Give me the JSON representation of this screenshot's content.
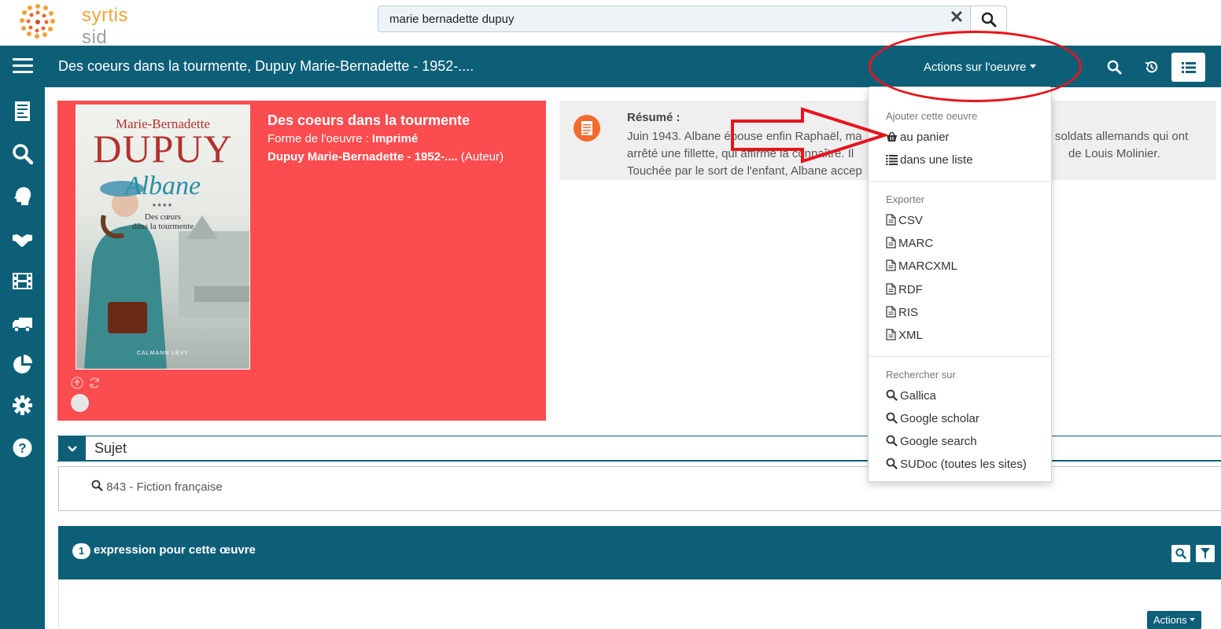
{
  "app": {
    "logo_main": "syrtis",
    "logo_sub": "sid"
  },
  "search": {
    "value": "marie bernadette dupuy"
  },
  "header": {
    "title": "Des coeurs dans la tourmente, Dupuy Marie-Bernadette - 1952-....",
    "actions_label": "Actions sur l'oeuvre"
  },
  "record": {
    "title": "Des coeurs dans la tourmente",
    "form_label": "Forme de l'oeuvre : ",
    "form_value": "Imprimé",
    "author": "Dupuy Marie-Bernadette - 1952-....",
    "author_role": "(Auteur)",
    "cover": {
      "author_first": "Marie-Bernadette",
      "author_last": "DUPUY",
      "series": "Albane",
      "stars": "****",
      "subtitle_line1": "Des cœurs",
      "subtitle_line2": "dans la tourmente",
      "publisher": "CALMANN LÉVY"
    }
  },
  "resume": {
    "label": "Résumé :",
    "line1": "Juin 1943. Albane épouse enfin Raphaël, ma",
    "line1_end": "soldats allemands qui ont",
    "line2": "arrêté une fillette, qui affirme la connaître. Il",
    "line2_end": "de Louis Molinier.",
    "line3": "Touchée par le sort de l'enfant, Albane accep"
  },
  "sujet": {
    "label": "Sujet",
    "item": "843 - Fiction française"
  },
  "expressions": {
    "count": "1",
    "label": "expression pour cette œuvre",
    "actions_label": "Actions"
  },
  "dropdown": {
    "section1_header": "Ajouter cette oeuvre",
    "basket": "au panier",
    "list": "dans une liste",
    "section2_header": "Exporter",
    "exports": [
      "CSV",
      "MARC",
      "MARCXML",
      "RDF",
      "RIS",
      "XML"
    ],
    "section3_header": "Rechercher sur",
    "search_targets": [
      "Gallica",
      "Google scholar",
      "Google search",
      "SUDoc (toutes les sites)"
    ]
  },
  "colors": {
    "primary": "#0d5f78",
    "card": "#fb4c4f",
    "annotation": "#e8141c",
    "logo_orange": "#f2a23a"
  }
}
